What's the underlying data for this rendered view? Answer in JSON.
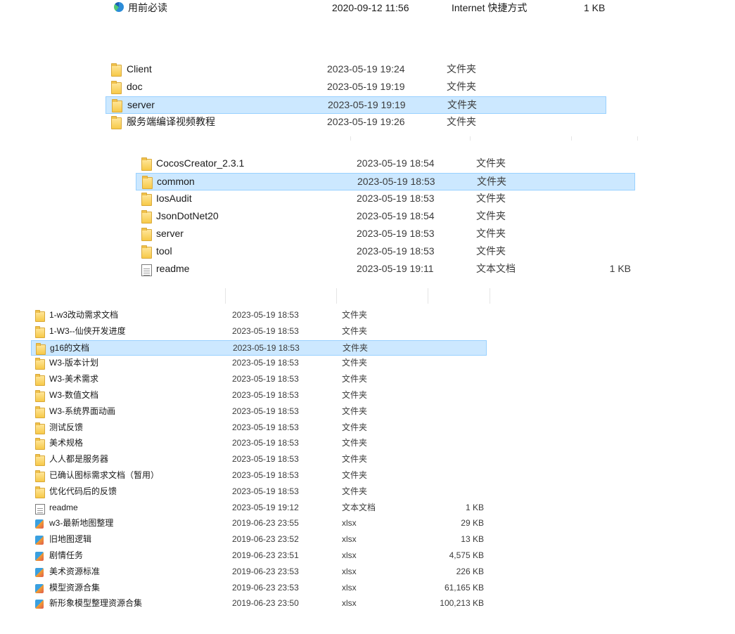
{
  "top": {
    "name": "用前必读",
    "date": "2020-09-12 11:56",
    "type": "Internet 快捷方式",
    "size": "1 KB",
    "icon": "edge-icon"
  },
  "panel_a": {
    "rows": [
      {
        "name": "Client",
        "date": "2023-05-19 19:24",
        "type": "文件夹",
        "icon": "folder-icon"
      },
      {
        "name": "doc",
        "date": "2023-05-19 19:19",
        "type": "文件夹",
        "icon": "folder-icon"
      },
      {
        "name": "server",
        "date": "2023-05-19 19:19",
        "type": "文件夹",
        "icon": "folder-icon",
        "selected": true
      },
      {
        "name": "服务端编译视频教程",
        "date": "2023-05-19 19:26",
        "type": "文件夹",
        "icon": "folder-icon"
      }
    ]
  },
  "panel_b": {
    "rows": [
      {
        "name": "CocosCreator_2.3.1",
        "date": "2023-05-19 18:54",
        "type": "文件夹",
        "size": "",
        "icon": "folder-icon"
      },
      {
        "name": "common",
        "date": "2023-05-19 18:53",
        "type": "文件夹",
        "size": "",
        "icon": "folder-icon",
        "selected": true
      },
      {
        "name": "IosAudit",
        "date": "2023-05-19 18:53",
        "type": "文件夹",
        "size": "",
        "icon": "folder-icon"
      },
      {
        "name": "JsonDotNet20",
        "date": "2023-05-19 18:54",
        "type": "文件夹",
        "size": "",
        "icon": "folder-icon"
      },
      {
        "name": "server",
        "date": "2023-05-19 18:53",
        "type": "文件夹",
        "size": "",
        "icon": "folder-icon"
      },
      {
        "name": "tool",
        "date": "2023-05-19 18:53",
        "type": "文件夹",
        "size": "",
        "icon": "folder-icon"
      },
      {
        "name": "readme",
        "date": "2023-05-19 19:11",
        "type": "文本文档",
        "size": "1 KB",
        "icon": "text-file-icon"
      }
    ]
  },
  "panel_c": {
    "rows": [
      {
        "name": "1-w3改动需求文档",
        "date": "2023-05-19 18:53",
        "type": "文件夹",
        "size": "",
        "icon": "folder-icon"
      },
      {
        "name": "1-W3--仙侠开发进度",
        "date": "2023-05-19 18:53",
        "type": "文件夹",
        "size": "",
        "icon": "folder-icon"
      },
      {
        "name": "g16的文档",
        "date": "2023-05-19 18:53",
        "type": "文件夹",
        "size": "",
        "icon": "folder-icon",
        "selected": true
      },
      {
        "name": "W3-版本计划",
        "date": "2023-05-19 18:53",
        "type": "文件夹",
        "size": "",
        "icon": "folder-icon"
      },
      {
        "name": "W3-美术需求",
        "date": "2023-05-19 18:53",
        "type": "文件夹",
        "size": "",
        "icon": "folder-icon"
      },
      {
        "name": "W3-数值文档",
        "date": "2023-05-19 18:53",
        "type": "文件夹",
        "size": "",
        "icon": "folder-icon"
      },
      {
        "name": "W3-系统界面动画",
        "date": "2023-05-19 18:53",
        "type": "文件夹",
        "size": "",
        "icon": "folder-icon"
      },
      {
        "name": "测试反馈",
        "date": "2023-05-19 18:53",
        "type": "文件夹",
        "size": "",
        "icon": "folder-icon"
      },
      {
        "name": "美术规格",
        "date": "2023-05-19 18:53",
        "type": "文件夹",
        "size": "",
        "icon": "folder-icon"
      },
      {
        "name": "人人都是服务器",
        "date": "2023-05-19 18:53",
        "type": "文件夹",
        "size": "",
        "icon": "folder-icon"
      },
      {
        "name": "已确认图标需求文档（暂用）",
        "date": "2023-05-19 18:53",
        "type": "文件夹",
        "size": "",
        "icon": "folder-icon"
      },
      {
        "name": "优化代码后的反馈",
        "date": "2023-05-19 18:53",
        "type": "文件夹",
        "size": "",
        "icon": "folder-icon"
      },
      {
        "name": "readme",
        "date": "2023-05-19 19:12",
        "type": "文本文档",
        "size": "1 KB",
        "icon": "text-file-icon"
      },
      {
        "name": "w3-最新地图整理",
        "date": "2019-06-23 23:55",
        "type": "xlsx",
        "size": "29 KB",
        "icon": "xlsx-file-icon"
      },
      {
        "name": "旧地图逻辑",
        "date": "2019-06-23 23:52",
        "type": "xlsx",
        "size": "13 KB",
        "icon": "xlsx-file-icon"
      },
      {
        "name": "剧情任务",
        "date": "2019-06-23 23:51",
        "type": "xlsx",
        "size": "4,575 KB",
        "icon": "xlsx-file-icon"
      },
      {
        "name": "美术资源标准",
        "date": "2019-06-23 23:53",
        "type": "xlsx",
        "size": "226 KB",
        "icon": "xlsx-file-icon"
      },
      {
        "name": "模型资源合集",
        "date": "2019-06-23 23:53",
        "type": "xlsx",
        "size": "61,165 KB",
        "icon": "xlsx-file-icon"
      },
      {
        "name": "新形象模型整理资源合集",
        "date": "2019-06-23 23:50",
        "type": "xlsx",
        "size": "100,213 KB",
        "icon": "xlsx-file-icon"
      }
    ]
  }
}
